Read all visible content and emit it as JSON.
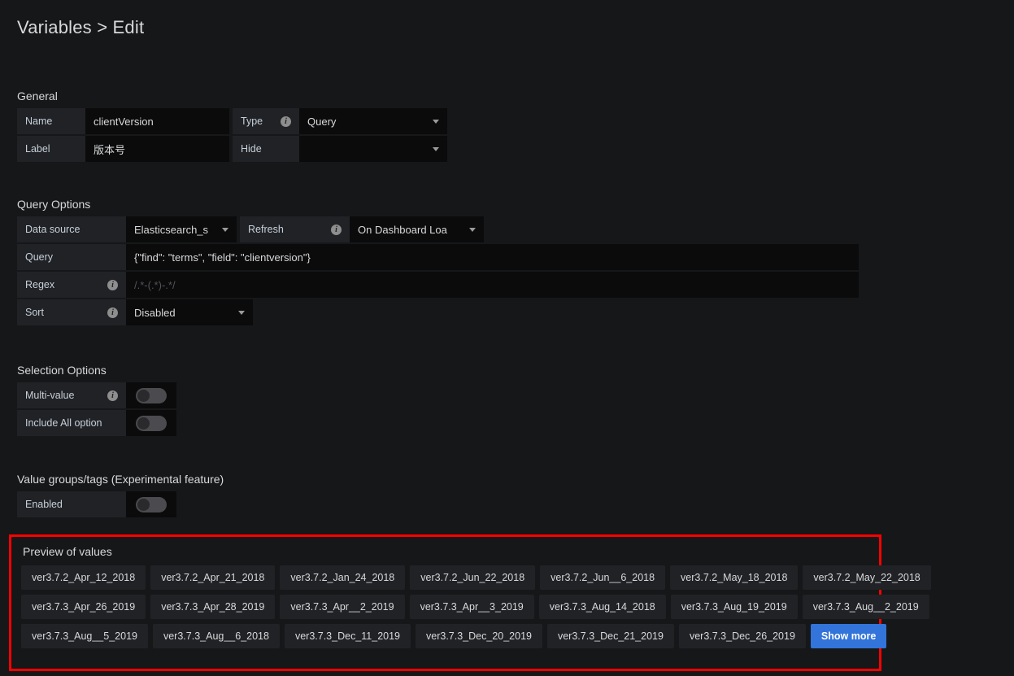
{
  "page": {
    "title": "Variables > Edit"
  },
  "general": {
    "heading": "General",
    "name": {
      "label": "Name",
      "value": "clientVersion"
    },
    "type": {
      "label": "Type",
      "value": "Query",
      "info_icon": "info-icon"
    },
    "label_field": {
      "label": "Label",
      "value": "版本号"
    },
    "hide": {
      "label": "Hide",
      "value": ""
    }
  },
  "query_options": {
    "heading": "Query Options",
    "datasource": {
      "label": "Data source",
      "value": "Elasticsearch_s"
    },
    "refresh": {
      "label": "Refresh",
      "value": "On Dashboard Loa",
      "info_icon": "info-icon"
    },
    "query": {
      "label": "Query",
      "value": "{\"find\": \"terms\", \"field\": \"clientversion\"}"
    },
    "regex": {
      "label": "Regex",
      "value": "",
      "placeholder": "/.*-(.*)-.*/",
      "info_icon": "info-icon"
    },
    "sort": {
      "label": "Sort",
      "value": "Disabled",
      "info_icon": "info-icon"
    }
  },
  "selection_options": {
    "heading": "Selection Options",
    "multi_value": {
      "label": "Multi-value",
      "state": "off",
      "info_icon": "info-icon"
    },
    "include_all": {
      "label": "Include All option",
      "state": "off"
    }
  },
  "value_groups": {
    "heading": "Value groups/tags (Experimental feature)",
    "enabled": {
      "label": "Enabled",
      "state": "off"
    }
  },
  "preview": {
    "heading": "Preview of values",
    "highlight_color": "#fe0000",
    "rows": [
      [
        "ver3.7.2_Apr_12_2018",
        "ver3.7.2_Apr_21_2018",
        "ver3.7.2_Jan_24_2018",
        "ver3.7.2_Jun_22_2018",
        "ver3.7.2_Jun__6_2018",
        "ver3.7.2_May_18_2018",
        "ver3.7.2_May_22_2018"
      ],
      [
        "ver3.7.3_Apr_26_2019",
        "ver3.7.3_Apr_28_2019",
        "ver3.7.3_Apr__2_2019",
        "ver3.7.3_Apr__3_2019",
        "ver3.7.3_Aug_14_2018",
        "ver3.7.3_Aug_19_2019",
        "ver3.7.3_Aug__2_2019"
      ],
      [
        "ver3.7.3_Aug__5_2019",
        "ver3.7.3_Aug__6_2018",
        "ver3.7.3_Dec_11_2019",
        "ver3.7.3_Dec_20_2019",
        "ver3.7.3_Dec_21_2019",
        "ver3.7.3_Dec_26_2019"
      ]
    ],
    "show_more_label": "Show more"
  }
}
